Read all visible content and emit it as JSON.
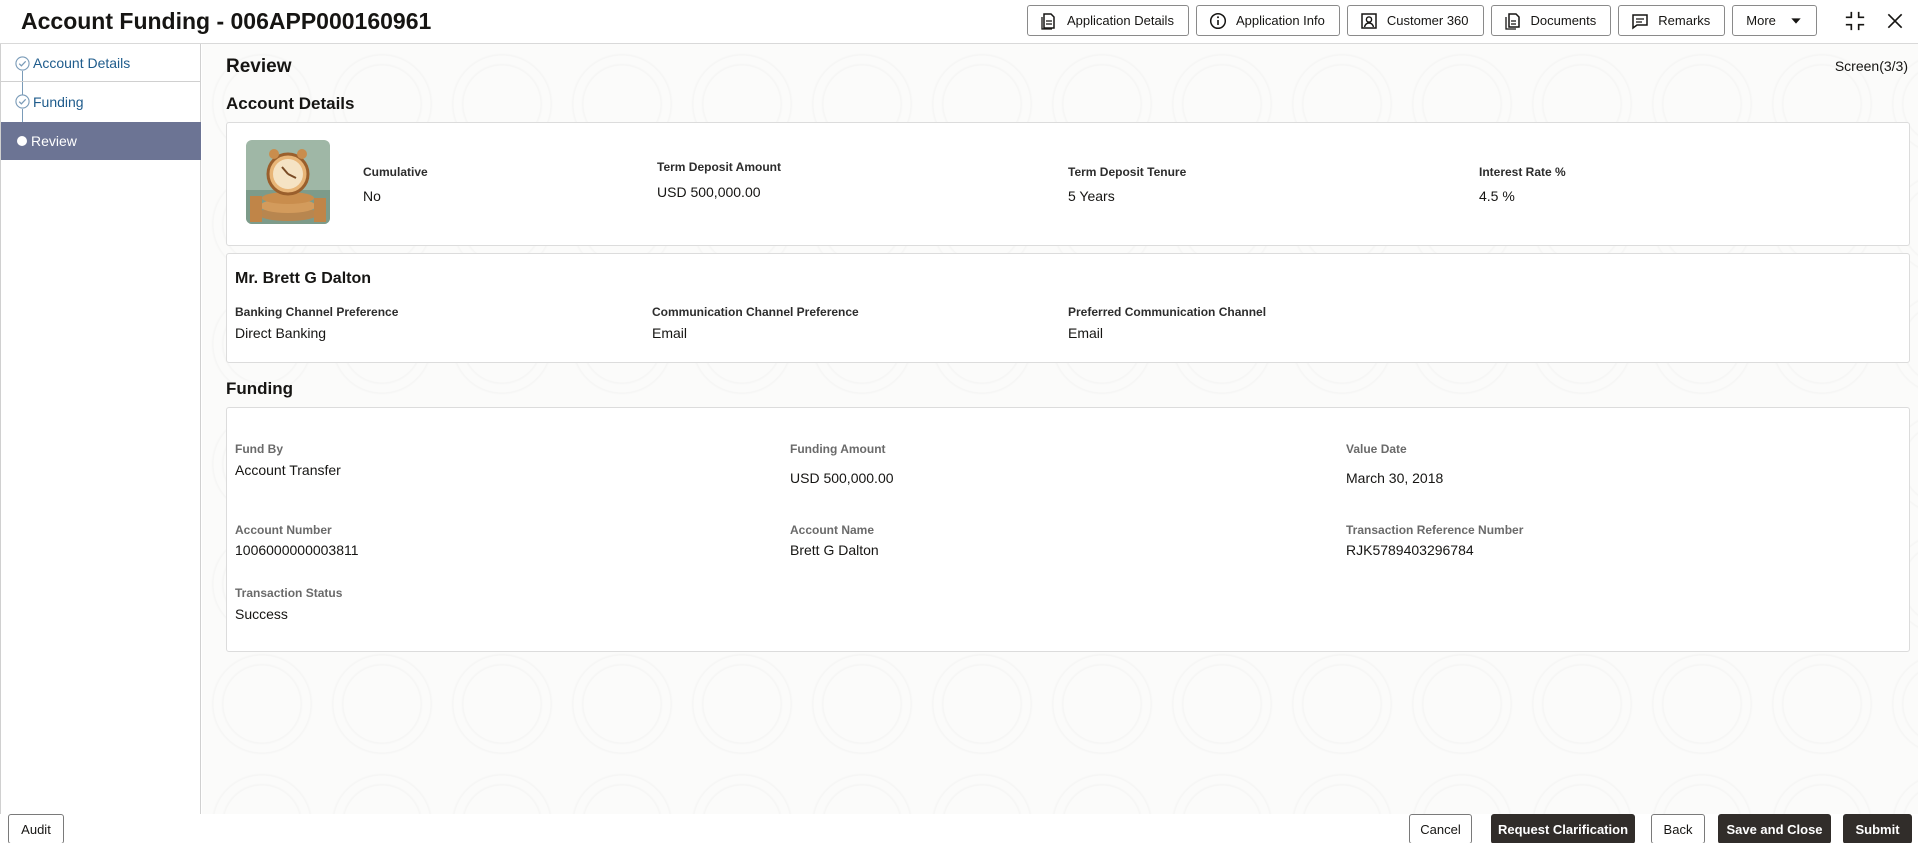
{
  "header": {
    "title": "Account Funding - 006APP000160961",
    "toolbar": [
      {
        "label": "Application Details",
        "icon": "document-icon"
      },
      {
        "label": "Application Info",
        "icon": "info-icon"
      },
      {
        "label": "Customer 360",
        "icon": "person-icon"
      },
      {
        "label": "Documents",
        "icon": "documents-icon"
      },
      {
        "label": "Remarks",
        "icon": "message-icon"
      }
    ],
    "more_label": "More"
  },
  "sidebar": {
    "steps": [
      {
        "label": "Account Details",
        "state": "completed"
      },
      {
        "label": "Funding",
        "state": "completed"
      },
      {
        "label": "Review",
        "state": "active"
      }
    ]
  },
  "main": {
    "title": "Review",
    "screen_count": "Screen(3/3)",
    "account_details": {
      "title": "Account Details",
      "fields": [
        {
          "label": "Cumulative",
          "value": "No"
        },
        {
          "label": "Term Deposit Amount",
          "value": "USD 500,000.00"
        },
        {
          "label": "Term Deposit Tenure",
          "value": "5 Years"
        },
        {
          "label": "Interest Rate %",
          "value": "4.5 %"
        }
      ]
    },
    "customer": {
      "name": "Mr. Brett G Dalton",
      "fields": [
        {
          "label": "Banking Channel Preference",
          "value": "Direct Banking"
        },
        {
          "label": "Communication Channel Preference",
          "value": "Email"
        },
        {
          "label": "Preferred Communication Channel",
          "value": "Email"
        }
      ]
    },
    "funding": {
      "title": "Funding",
      "fields": [
        {
          "label": "Fund By",
          "value": "Account Transfer"
        },
        {
          "label": "Funding Amount",
          "value": "USD 500,000.00"
        },
        {
          "label": "Value Date",
          "value": "March 30, 2018"
        },
        {
          "label": "Account Number",
          "value": "1006000000003811"
        },
        {
          "label": "Account Name",
          "value": "Brett G Dalton"
        },
        {
          "label": "Transaction Reference Number",
          "value": "RJK5789403296784"
        },
        {
          "label": "Transaction Status",
          "value": "Success"
        }
      ]
    }
  },
  "footer": {
    "audit": "Audit",
    "cancel": "Cancel",
    "request_clarification": "Request Clarification",
    "back": "Back",
    "save_and_close": "Save and Close",
    "submit": "Submit"
  },
  "colors": {
    "active_step_bg": "#6c7494",
    "step_link": "#1f5c8c",
    "primary_button": "#312d2a"
  }
}
